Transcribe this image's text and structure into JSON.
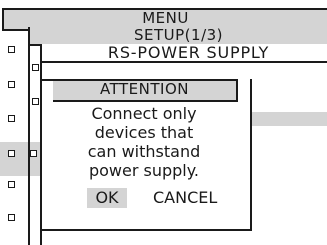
{
  "menu": {
    "title": "MENU"
  },
  "setup": {
    "title": "SETUP(1/3)"
  },
  "submenu": {
    "title": "RS-POWER SUPPLY"
  },
  "dialog": {
    "title": "ATTENTION",
    "message_lines": [
      "Connect only",
      "devices that",
      "can withstand",
      "power supply."
    ],
    "ok_label": "OK",
    "cancel_label": "CANCEL"
  },
  "colors": {
    "background": "#ffffff",
    "bar_gray": "#d4d4d4",
    "ink": "#1a1a1a"
  }
}
